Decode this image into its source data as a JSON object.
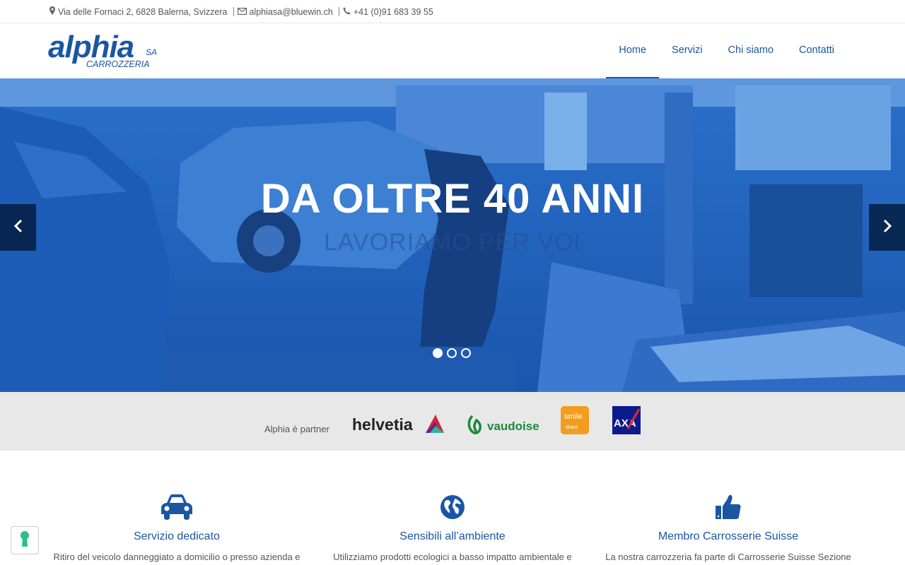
{
  "topbar": {
    "address": "Via delle Fornaci 2, 6828 Balerna, Svizzera",
    "email": "alphiasa@bluewin.ch",
    "phone": "+41 (0)91 683 39 55"
  },
  "logo": {
    "name": "alphia",
    "suffix": "SA",
    "tagline": "CARROZZERIA"
  },
  "nav": {
    "items": [
      "Home",
      "Servizi",
      "Chi siamo",
      "Contatti"
    ],
    "active": "Home"
  },
  "hero": {
    "title": "DA OLTRE 40 ANNI",
    "subtitle": "LAVORIAMO PER VOI",
    "slide_count": 3,
    "active_slide": 1
  },
  "partners": {
    "label": "Alphia è partner",
    "logos": [
      "helvetia",
      "vaudoise",
      "smile direct",
      "AXA"
    ]
  },
  "features": [
    {
      "icon": "car-icon",
      "title": "Servizio dedicato",
      "text": "Ritiro del veicolo danneggiato a domicilio o presso azienda e"
    },
    {
      "icon": "globe-icon",
      "title": "Sensibili all’ambiente",
      "text": "Utilizziamo prodotti ecologici a basso impatto ambientale e"
    },
    {
      "icon": "thumbs-up-icon",
      "title": "Membro Carrosserie Suisse",
      "text": "La nostra carrozzeria fa parte di Carrosserie Suisse Sezione"
    }
  ],
  "colors": {
    "brand_blue": "#1b56a3",
    "hero_overlay": "#1f63c2",
    "partners_bg": "#e8e8e8",
    "lock_green": "#2bbf8a"
  }
}
